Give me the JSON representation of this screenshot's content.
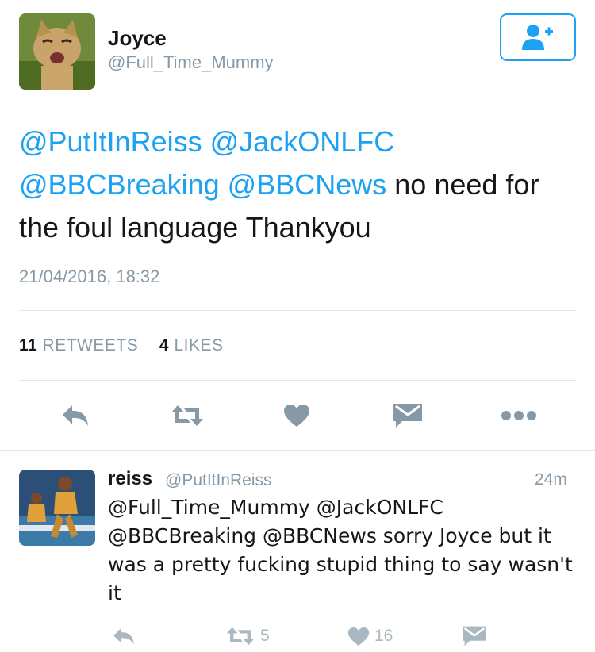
{
  "tweet": {
    "display_name": "Joyce",
    "handle": "@Full_Time_Mummy",
    "text_mentions": [
      "@PutItInReiss",
      "@JackONLFC",
      "@BBCBreaking",
      "@BBCNews"
    ],
    "text_body": "no need for the foul language Thankyou",
    "timestamp": "21/04/2016, 18:32",
    "retweets_count": "11",
    "retweets_label": "RETWEETS",
    "likes_count": "4",
    "likes_label": "LIKES",
    "icons": [
      "add-user-icon",
      "reply-icon",
      "retweet-icon",
      "like-icon",
      "direct-message-icon",
      "more-icon"
    ]
  },
  "reply": {
    "display_name": "reiss",
    "handle": "@PutItInReiss",
    "time": "24m",
    "text": "@Full_Time_Mummy @JackONLFC @BBCBreaking @BBCNews sorry Joyce but it was a pretty fucking stupid thing to say wasn't it",
    "retweet_count": "5",
    "like_count": "16"
  },
  "colors": {
    "accent": "#1da1f2",
    "muted": "#8899a6",
    "icon": "#8899a6",
    "divider": "#e1e8ed"
  }
}
